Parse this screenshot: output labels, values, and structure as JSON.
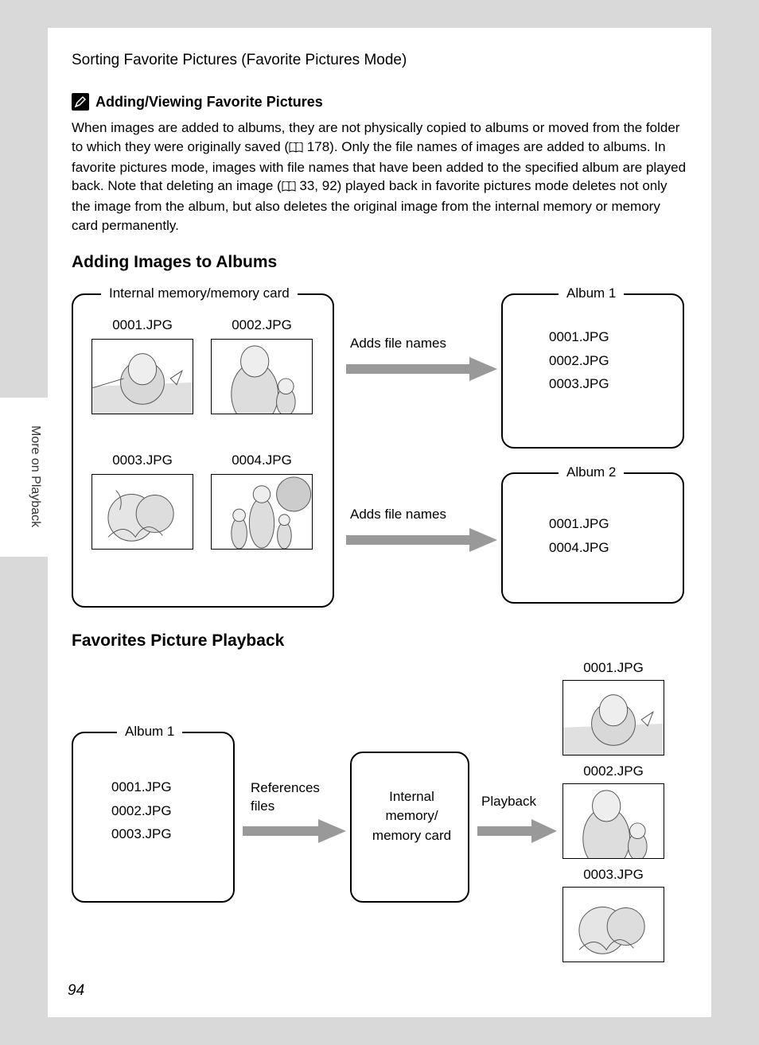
{
  "header": "Sorting Favorite Pictures (Favorite Pictures Mode)",
  "sidebarLabel": "More on Playback",
  "note": {
    "title": "Adding/Viewing Favorite Pictures",
    "body_a": "When images are added to albums, they are not physically copied to albums or moved from the folder to which they were originally saved (",
    "ref1": " 178). Only the file names of images are added to albums. In favorite pictures mode, images with file names that have been added to the specified album are played back. Note that deleting an image (",
    "ref2": " 33, 92) played back in favorite pictures mode deletes not only the image from the album, but also deletes the original image from the internal memory or memory card permanently."
  },
  "section1": {
    "title": "Adding Images to Albums",
    "sourceLabel": "Internal memory/memory card",
    "files": [
      "0001.JPG",
      "0002.JPG",
      "0003.JPG",
      "0004.JPG"
    ],
    "arrowLabel": "Adds file names",
    "album1": {
      "label": "Album 1",
      "files": [
        "0001.JPG",
        "0002.JPG",
        "0003.JPG"
      ]
    },
    "album2": {
      "label": "Album 2",
      "files": [
        "0001.JPG",
        "0004.JPG"
      ]
    }
  },
  "section2": {
    "title": "Favorites Picture Playback",
    "album": {
      "label": "Album 1",
      "files": [
        "0001.JPG",
        "0002.JPG",
        "0003.JPG"
      ]
    },
    "refLabel": "References files",
    "memLabel": "Internal memory/ memory card",
    "playbackLabel": "Playback",
    "outFiles": [
      "0001.JPG",
      "0002.JPG",
      "0003.JPG"
    ]
  },
  "pageNumber": "94"
}
